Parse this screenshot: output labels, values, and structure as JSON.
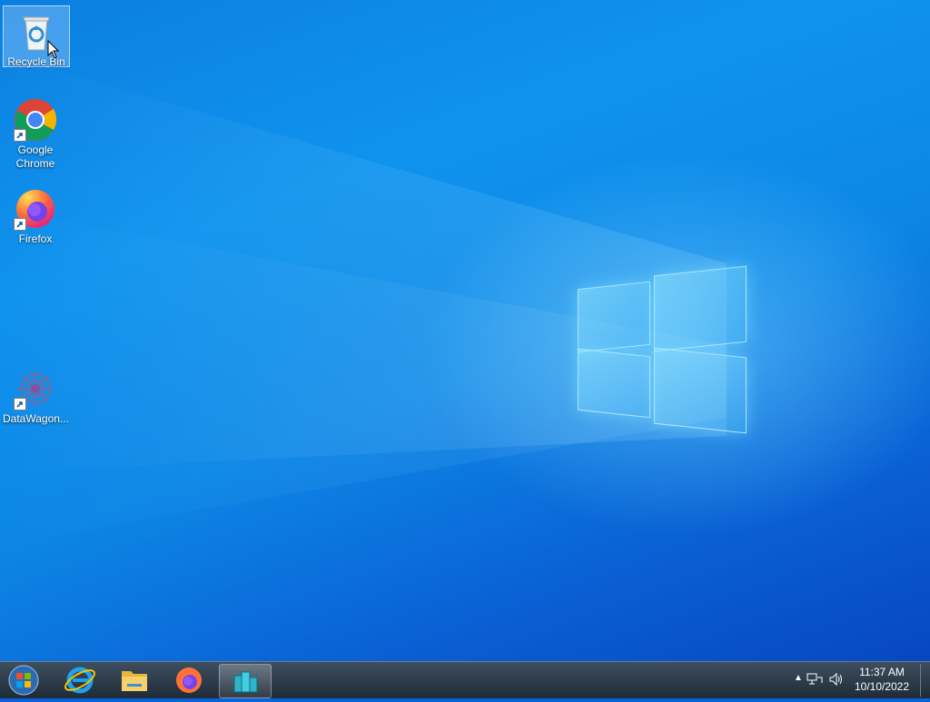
{
  "desktop": {
    "icons": [
      {
        "label": "Recycle Bin",
        "icon": "recycle-bin-icon"
      },
      {
        "label": "Google\nChrome",
        "icon": "chrome-icon"
      },
      {
        "label": "Firefox",
        "icon": "firefox-icon"
      },
      {
        "label": "DataWagon...",
        "icon": "datawagon-icon"
      }
    ]
  },
  "taskbar": {
    "pinned": [
      {
        "name": "Internet Explorer",
        "icon": "ie-icon"
      },
      {
        "name": "File Explorer",
        "icon": "folder-icon"
      },
      {
        "name": "Firefox",
        "icon": "firefox-icon"
      },
      {
        "name": "Server Manager",
        "icon": "server-manager-icon"
      }
    ],
    "tray": {
      "time": "11:37 AM",
      "date": "10/10/2022"
    }
  },
  "colors": {
    "wallpaper_blue": "#0c86e6",
    "taskbar": "#2a3845"
  }
}
